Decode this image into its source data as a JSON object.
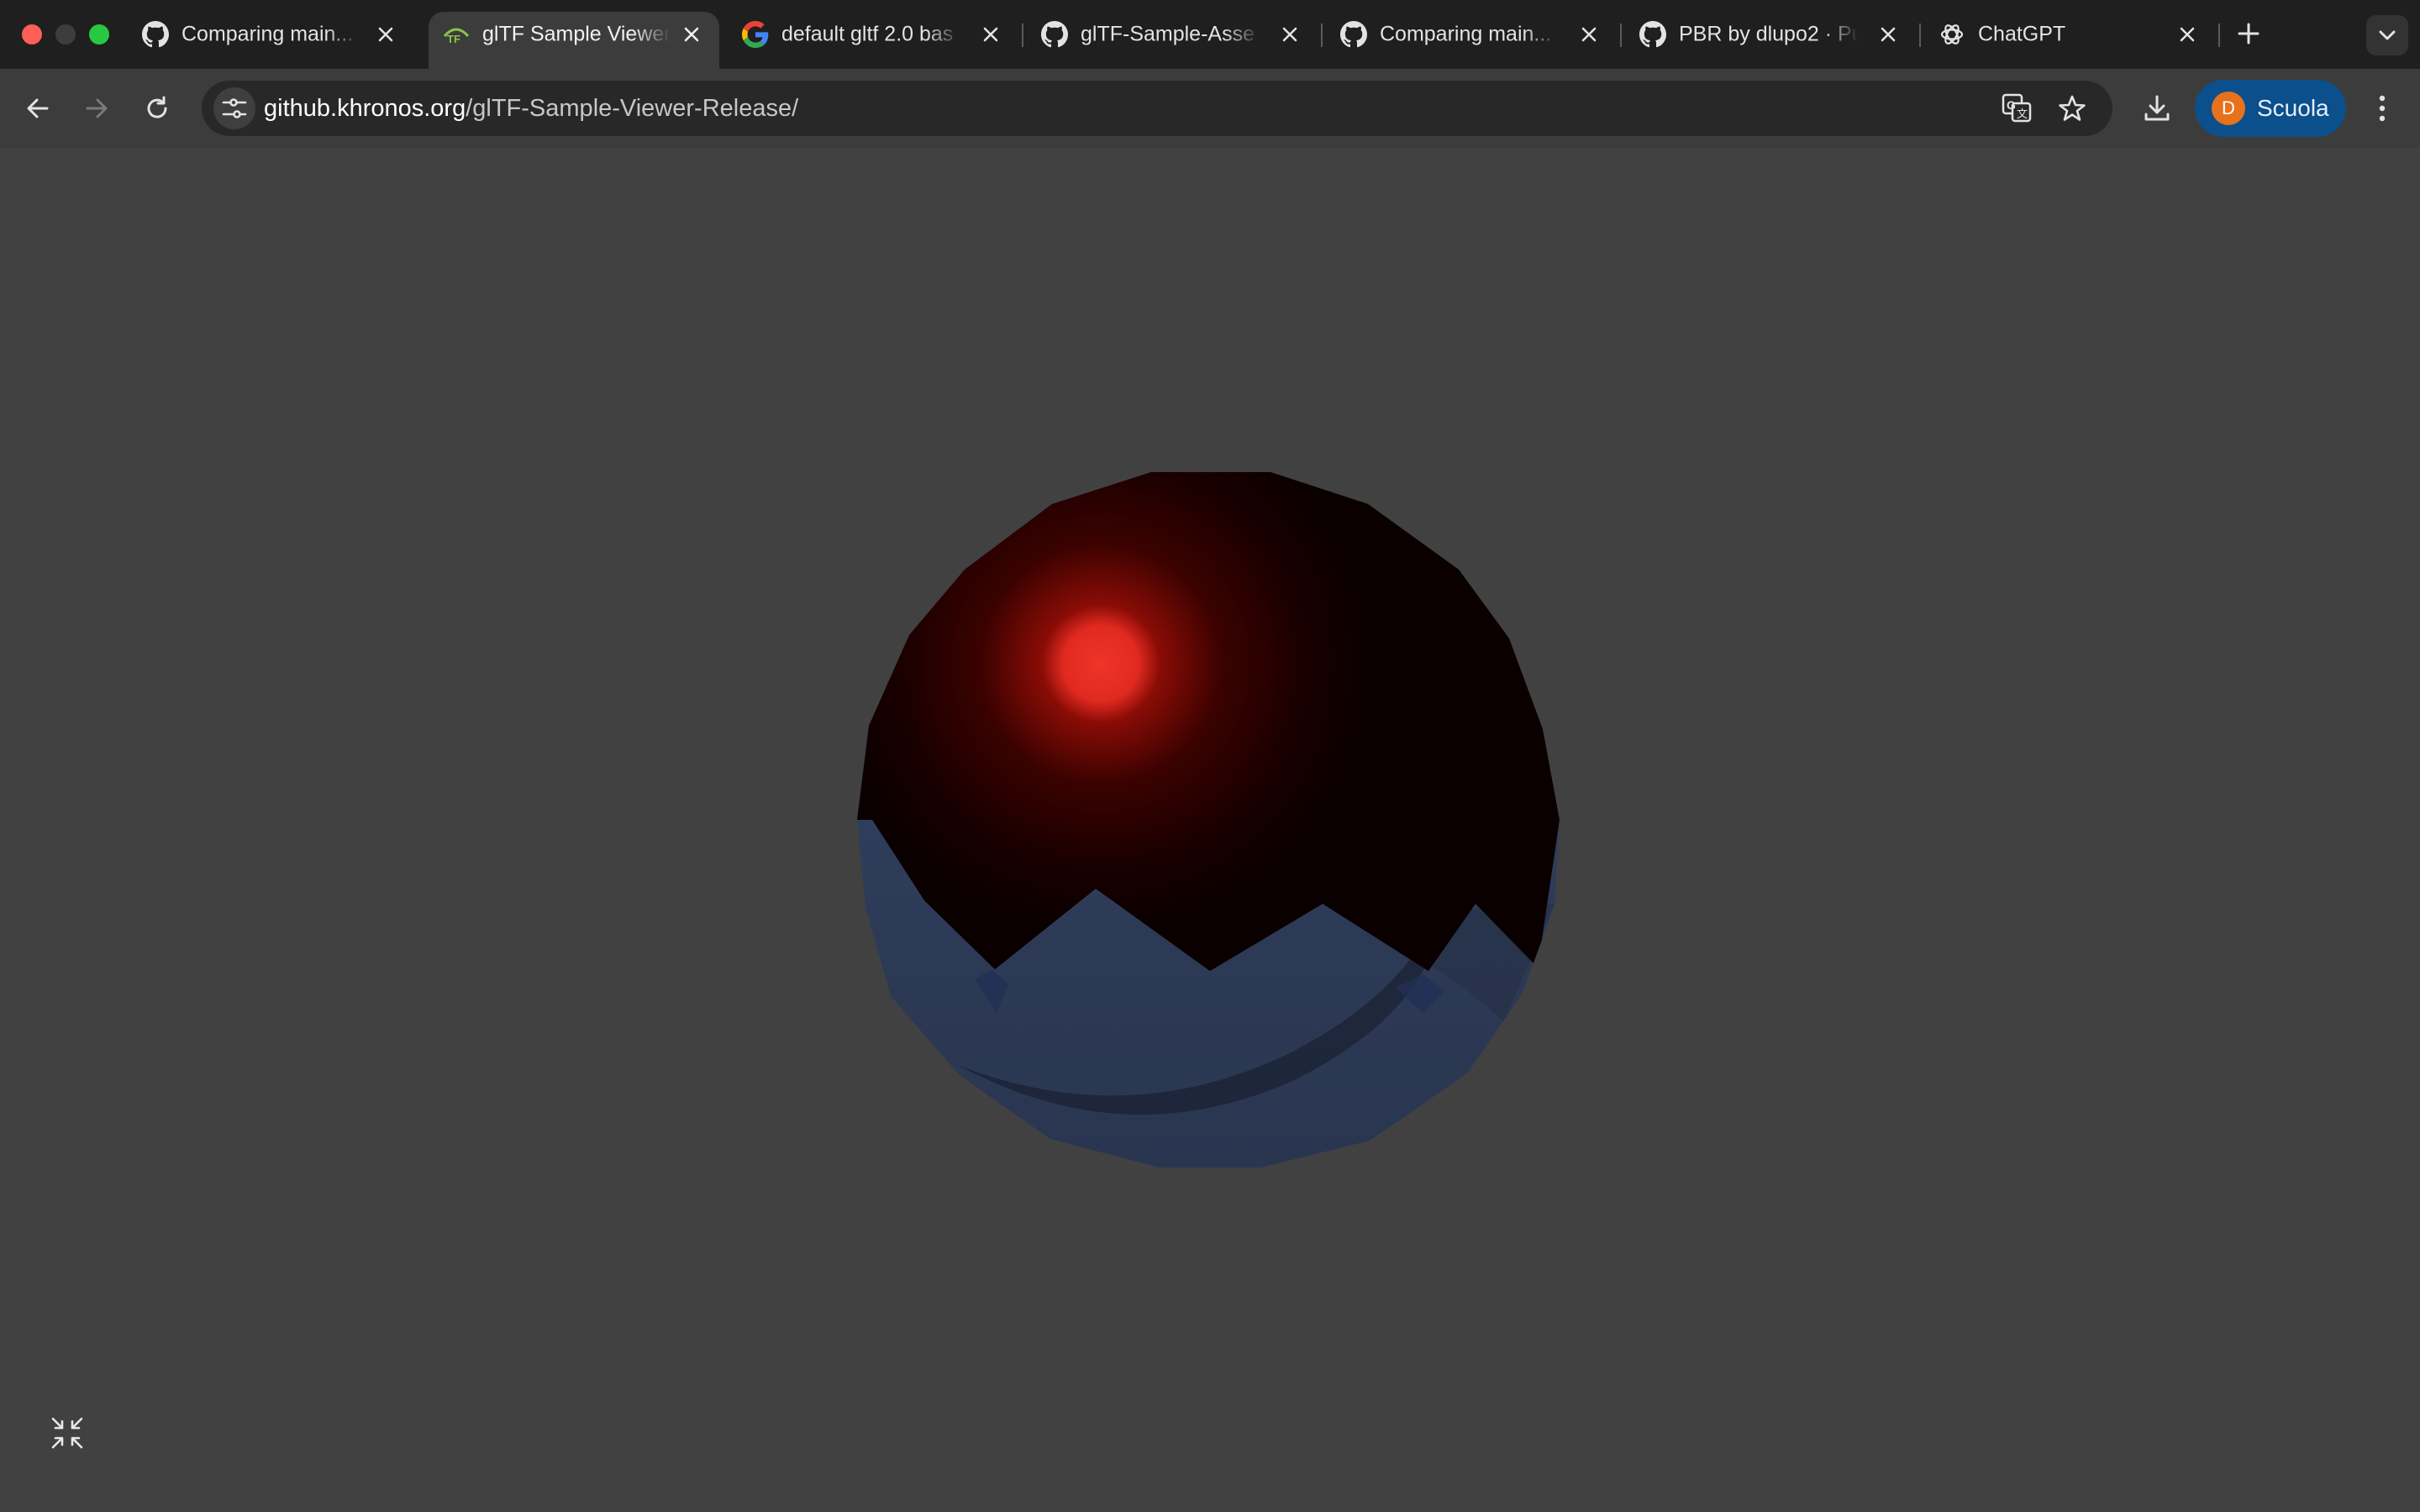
{
  "browser": {
    "tabs": [
      {
        "title": "Comparing main...",
        "favicon": "github-icon",
        "active": false
      },
      {
        "title": "glTF Sample Viewer",
        "favicon": "gltf-icon",
        "active": true
      },
      {
        "title": "default gltf 2.0 bas",
        "favicon": "google-icon",
        "active": false
      },
      {
        "title": "glTF-Sample-Asse",
        "favicon": "github-icon",
        "active": false
      },
      {
        "title": "Comparing main...",
        "favicon": "github-icon",
        "active": false
      },
      {
        "title": "PBR by dlupo2 · Pu",
        "favicon": "github-icon",
        "active": false
      },
      {
        "title": "ChatGPT",
        "favicon": "chatgpt-icon",
        "active": false
      }
    ],
    "address_bar": {
      "host": "github.khronos.org",
      "path": "/glTF-Sample-Viewer-Release/"
    },
    "profile": {
      "initial": "D",
      "name": "Scuola"
    }
  },
  "viewer": {
    "background_color": "#414141",
    "model": "sphere",
    "upper_color": "#1a0000",
    "highlight_color": "#f0342a",
    "lower_color": "#2e3b57"
  }
}
